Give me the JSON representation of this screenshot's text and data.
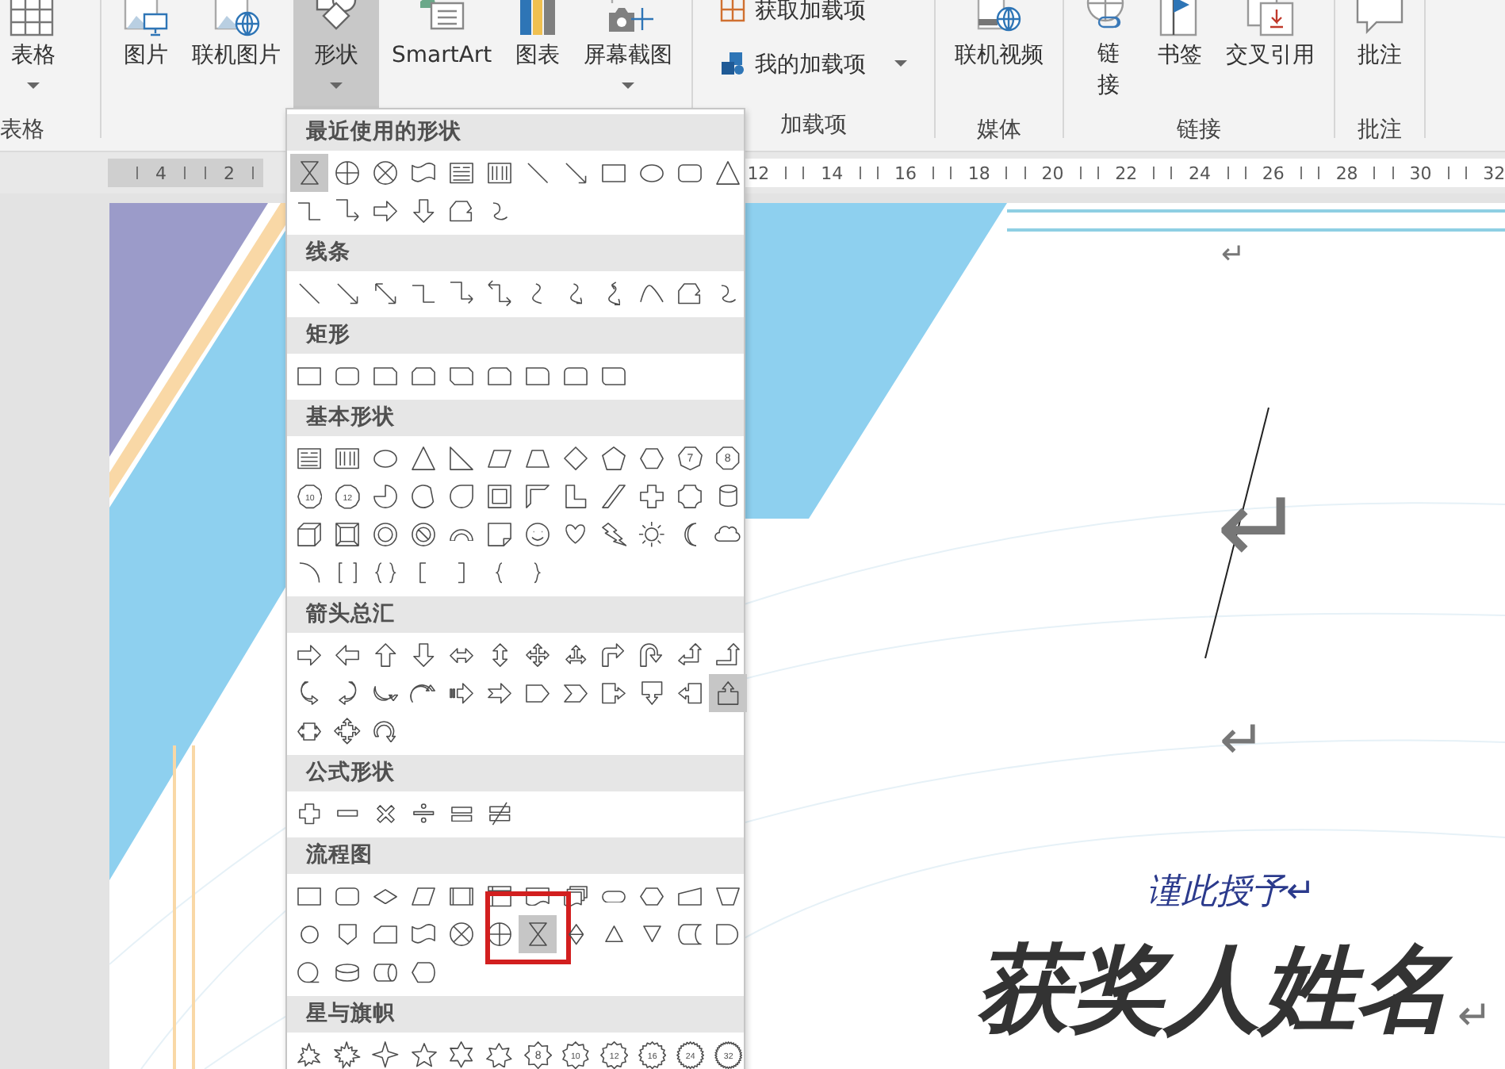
{
  "ribbon": {
    "groups": [
      {
        "label": "表格",
        "buttons": [
          {
            "label": "表格",
            "kind": "table",
            "dropdown": true,
            "selected": false
          }
        ]
      },
      {
        "buttons": [
          {
            "label": "图片",
            "kind": "picture",
            "dropdown": false,
            "selected": false
          },
          {
            "label": "联机图片",
            "kind": "online-picture",
            "dropdown": false,
            "selected": false
          },
          {
            "label": "形状",
            "kind": "shapes",
            "dropdown": true,
            "selected": true
          },
          {
            "label": "SmartArt",
            "kind": "smartart",
            "dropdown": false,
            "selected": false
          },
          {
            "label": "图表",
            "kind": "chart",
            "dropdown": false,
            "selected": false
          },
          {
            "label": "屏幕截图",
            "kind": "screenshot",
            "dropdown": true,
            "selected": false
          }
        ]
      },
      {
        "label": "加载项",
        "small": true,
        "buttons": [
          {
            "label": "获取加载项",
            "kind": "store",
            "dropdown": false,
            "selected": false
          },
          {
            "label": "我的加载项",
            "kind": "addins",
            "dropdown": true,
            "selected": false
          }
        ]
      },
      {
        "label": "媒体",
        "buttons": [
          {
            "label": "联机视频",
            "kind": "online-video",
            "dropdown": false,
            "selected": false
          }
        ]
      },
      {
        "label": "链接",
        "buttons": [
          {
            "label": "链接",
            "kind": "link",
            "dropdown": false,
            "selected": false
          },
          {
            "label": "书签",
            "kind": "bookmark",
            "dropdown": false,
            "selected": false
          },
          {
            "label": "交叉引用",
            "kind": "crossref",
            "dropdown": false,
            "selected": false
          }
        ]
      },
      {
        "label": "批注",
        "buttons": [
          {
            "label": "批注",
            "kind": "comment",
            "dropdown": false,
            "selected": false
          }
        ]
      }
    ]
  },
  "ruler": {
    "left_labels": [
      "4",
      "2"
    ],
    "right_labels": [
      "12",
      "14",
      "16",
      "18",
      "20",
      "22",
      "24",
      "26",
      "28",
      "30",
      "32"
    ]
  },
  "shapes_menu": {
    "sections": [
      {
        "title": "最近使用的形状",
        "items": [
          {
            "kind": "hourglass",
            "selected": true
          },
          {
            "kind": "or-circle",
            "selected": false
          },
          {
            "kind": "sum-circle",
            "selected": false
          },
          {
            "kind": "punched-tape",
            "selected": false
          },
          {
            "kind": "textbox",
            "selected": false
          },
          {
            "kind": "vtextbox",
            "selected": false
          },
          {
            "kind": "line",
            "selected": false
          },
          {
            "kind": "arrow-line",
            "selected": false
          },
          {
            "kind": "rect",
            "selected": false
          },
          {
            "kind": "ellipse",
            "selected": false
          },
          {
            "kind": "roundrect",
            "selected": false
          },
          {
            "kind": "triangle",
            "selected": false
          },
          {
            "kind": "elbow",
            "selected": false
          },
          {
            "kind": "elbow-arrow",
            "selected": false
          },
          {
            "kind": "arrow-right",
            "selected": false
          },
          {
            "kind": "arrow-down",
            "selected": false
          },
          {
            "kind": "freeform",
            "selected": false
          },
          {
            "kind": "scribble",
            "selected": false
          }
        ]
      },
      {
        "title": "线条",
        "items": [
          {
            "kind": "line",
            "selected": false
          },
          {
            "kind": "arrow-line",
            "selected": false
          },
          {
            "kind": "double-arrow-line",
            "selected": false
          },
          {
            "kind": "elbow",
            "selected": false
          },
          {
            "kind": "elbow-arrow",
            "selected": false
          },
          {
            "kind": "elbow-double-arrow",
            "selected": false
          },
          {
            "kind": "curve",
            "selected": false
          },
          {
            "kind": "curve-arrow",
            "selected": false
          },
          {
            "kind": "curve-double-arrow",
            "selected": false
          },
          {
            "kind": "arc-curve",
            "selected": false
          },
          {
            "kind": "freeform",
            "selected": false
          },
          {
            "kind": "scribble",
            "selected": false
          }
        ]
      },
      {
        "title": "矩形",
        "items": [
          {
            "kind": "rect",
            "selected": false
          },
          {
            "kind": "roundrect",
            "selected": false
          },
          {
            "kind": "snip1",
            "selected": false
          },
          {
            "kind": "snip2same",
            "selected": false
          },
          {
            "kind": "snip2diag",
            "selected": false
          },
          {
            "kind": "snip-round",
            "selected": false
          },
          {
            "kind": "round1",
            "selected": false
          },
          {
            "kind": "round2same",
            "selected": false
          },
          {
            "kind": "round2diag",
            "selected": false
          }
        ]
      },
      {
        "title": "基本形状",
        "items": [
          {
            "kind": "textbox",
            "selected": false
          },
          {
            "kind": "vtextbox",
            "selected": false
          },
          {
            "kind": "ellipse",
            "selected": false
          },
          {
            "kind": "triangle",
            "selected": false
          },
          {
            "kind": "right-triangle",
            "selected": false
          },
          {
            "kind": "parallelogram",
            "selected": false
          },
          {
            "kind": "trapezoid",
            "selected": false
          },
          {
            "kind": "diamond",
            "selected": false
          },
          {
            "kind": "pentagon",
            "selected": false
          },
          {
            "kind": "hexagon",
            "selected": false
          },
          {
            "kind": "heptagon",
            "text": "7",
            "selected": false
          },
          {
            "kind": "octagon",
            "text": "8",
            "selected": false
          },
          {
            "kind": "decagon",
            "text": "10",
            "selected": false
          },
          {
            "kind": "dodecagon",
            "text": "12",
            "selected": false
          },
          {
            "kind": "pie",
            "selected": false
          },
          {
            "kind": "chord",
            "selected": false
          },
          {
            "kind": "teardrop",
            "selected": false
          },
          {
            "kind": "frame",
            "selected": false
          },
          {
            "kind": "half-frame",
            "selected": false
          },
          {
            "kind": "l-shape",
            "selected": false
          },
          {
            "kind": "diag-stripe",
            "selected": false
          },
          {
            "kind": "cross",
            "selected": false
          },
          {
            "kind": "plaque",
            "selected": false
          },
          {
            "kind": "can",
            "selected": false
          },
          {
            "kind": "cube",
            "selected": false
          },
          {
            "kind": "bevel",
            "selected": false
          },
          {
            "kind": "donut",
            "selected": false
          },
          {
            "kind": "no-symbol",
            "selected": false
          },
          {
            "kind": "block-arc",
            "selected": false
          },
          {
            "kind": "folded-corner",
            "selected": false
          },
          {
            "kind": "smiley",
            "selected": false
          },
          {
            "kind": "heart",
            "selected": false
          },
          {
            "kind": "lightning",
            "selected": false
          },
          {
            "kind": "sun",
            "selected": false
          },
          {
            "kind": "moon",
            "selected": false
          },
          {
            "kind": "cloud",
            "selected": false
          },
          {
            "kind": "arc",
            "selected": false
          },
          {
            "kind": "double-bracket",
            "selected": false
          },
          {
            "kind": "double-brace",
            "selected": false
          },
          {
            "kind": "left-bracket",
            "selected": false
          },
          {
            "kind": "right-bracket",
            "selected": false
          },
          {
            "kind": "left-brace",
            "selected": false
          },
          {
            "kind": "right-brace",
            "selected": false
          }
        ]
      },
      {
        "title": "箭头总汇",
        "items": [
          {
            "kind": "arrow-right",
            "selected": false
          },
          {
            "kind": "arrow-left",
            "selected": false
          },
          {
            "kind": "arrow-up",
            "selected": false
          },
          {
            "kind": "arrow-down",
            "selected": false
          },
          {
            "kind": "left-right-arrow",
            "selected": false
          },
          {
            "kind": "up-down-arrow",
            "selected": false
          },
          {
            "kind": "quad-arrow",
            "selected": false
          },
          {
            "kind": "left-right-up-arrow",
            "selected": false
          },
          {
            "kind": "bent-arrow",
            "selected": false
          },
          {
            "kind": "u-turn-arrow",
            "selected": false
          },
          {
            "kind": "left-up-arrow",
            "selected": false
          },
          {
            "kind": "bent-up-arrow",
            "selected": false
          },
          {
            "kind": "curved-right-arrow",
            "selected": false
          },
          {
            "kind": "curved-left-arrow",
            "selected": false
          },
          {
            "kind": "curved-up-arrow",
            "selected": false
          },
          {
            "kind": "curved-down-arrow",
            "selected": false
          },
          {
            "kind": "striped-right-arrow",
            "selected": false
          },
          {
            "kind": "notched-right-arrow",
            "selected": false
          },
          {
            "kind": "home-plate",
            "selected": false
          },
          {
            "kind": "chevron",
            "selected": false
          },
          {
            "kind": "right-callout",
            "selected": false
          },
          {
            "kind": "down-callout",
            "selected": false
          },
          {
            "kind": "left-callout",
            "selected": false
          },
          {
            "kind": "up-callout",
            "selected": true
          },
          {
            "kind": "left-right-callout",
            "selected": false
          },
          {
            "kind": "quad-callout",
            "selected": false
          },
          {
            "kind": "circular-arrow",
            "selected": false
          }
        ]
      },
      {
        "title": "公式形状",
        "items": [
          {
            "kind": "plus",
            "selected": false
          },
          {
            "kind": "minus",
            "selected": false
          },
          {
            "kind": "multiply",
            "selected": false
          },
          {
            "kind": "divide",
            "selected": false
          },
          {
            "kind": "equal",
            "selected": false
          },
          {
            "kind": "not-equal",
            "selected": false
          }
        ]
      },
      {
        "title": "流程图",
        "items": [
          {
            "kind": "rect",
            "selected": false
          },
          {
            "kind": "roundrect",
            "selected": false
          },
          {
            "kind": "decision",
            "selected": false
          },
          {
            "kind": "parallelogram",
            "selected": false
          },
          {
            "kind": "predefined",
            "selected": false
          },
          {
            "kind": "internal-storage",
            "selected": false
          },
          {
            "kind": "document",
            "selected": false
          },
          {
            "kind": "multidocument",
            "selected": false
          },
          {
            "kind": "terminator",
            "selected": false
          },
          {
            "kind": "preparation",
            "selected": false
          },
          {
            "kind": "manual-input",
            "selected": false
          },
          {
            "kind": "manual-operation",
            "selected": false
          },
          {
            "kind": "connector",
            "selected": false
          },
          {
            "kind": "offpage",
            "selected": false
          },
          {
            "kind": "card",
            "selected": false
          },
          {
            "kind": "punched-tape",
            "selected": false
          },
          {
            "kind": "sum-circle",
            "selected": false
          },
          {
            "kind": "or-circle",
            "selected": false
          },
          {
            "kind": "hourglass",
            "selected": true,
            "annotated": true
          },
          {
            "kind": "sort",
            "selected": false
          },
          {
            "kind": "extract",
            "selected": false
          },
          {
            "kind": "merge",
            "selected": false
          },
          {
            "kind": "stored-data",
            "selected": false
          },
          {
            "kind": "delay",
            "selected": false
          },
          {
            "kind": "sequential-access",
            "selected": false
          },
          {
            "kind": "magnetic-disk",
            "selected": false
          },
          {
            "kind": "direct-access",
            "selected": false
          },
          {
            "kind": "display",
            "selected": false
          }
        ]
      },
      {
        "title": "星与旗帜",
        "items": [
          {
            "kind": "explosion1",
            "selected": false
          },
          {
            "kind": "explosion2",
            "selected": false
          },
          {
            "kind": "star4",
            "selected": false
          },
          {
            "kind": "star5",
            "selected": false
          },
          {
            "kind": "star6",
            "selected": false
          },
          {
            "kind": "star7",
            "selected": false
          },
          {
            "kind": "star8",
            "text": "8",
            "selected": false
          },
          {
            "kind": "star10",
            "text": "10",
            "selected": false
          },
          {
            "kind": "star12",
            "text": "12",
            "selected": false
          },
          {
            "kind": "star16",
            "text": "16",
            "selected": false
          },
          {
            "kind": "star24",
            "text": "24",
            "selected": false
          },
          {
            "kind": "star32",
            "text": "32",
            "selected": false
          }
        ]
      }
    ]
  },
  "document": {
    "items": [
      {
        "kind": "mark",
        "text": "↵"
      },
      {
        "kind": "big-mark",
        "text": "↵"
      },
      {
        "kind": "medium-mark",
        "text": "↵"
      },
      {
        "kind": "subtitle",
        "text": "谨此授予↵"
      },
      {
        "kind": "title",
        "text": "获奖人姓名"
      },
      {
        "kind": "edge-mark",
        "text": "↵"
      }
    ]
  }
}
